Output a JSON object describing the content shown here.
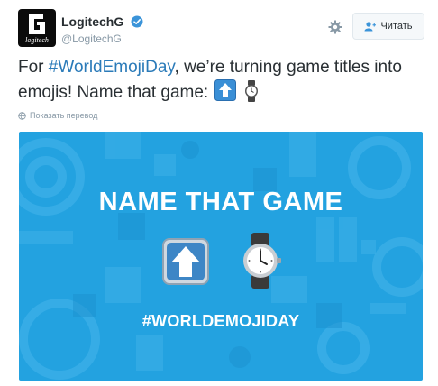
{
  "user": {
    "display_name": "LogitechG",
    "handle": "@LogitechG",
    "avatar_text": "logitech",
    "verified": true
  },
  "actions": {
    "follow_label": "Читать"
  },
  "tweet": {
    "text_before": "For ",
    "hashtag": "#WorldEmojiDay",
    "text_after": ", we’re turning game titles into emojis! Name that game:",
    "translate_label": "Показать перевод"
  },
  "media": {
    "title": "NAME THAT GAME",
    "hashtag": "#WORLDEMOJIDAY"
  },
  "icons": {
    "settings": "gear-icon",
    "follow": "add-user-icon",
    "translate": "globe-icon",
    "verified": "verified-badge-icon",
    "emoji1": "up-arrow-emoji",
    "emoji2": "watch-emoji"
  },
  "colors": {
    "accent": "#2b7bb9",
    "media_bg": "#23a2e0",
    "verified": "#3b94d9"
  }
}
